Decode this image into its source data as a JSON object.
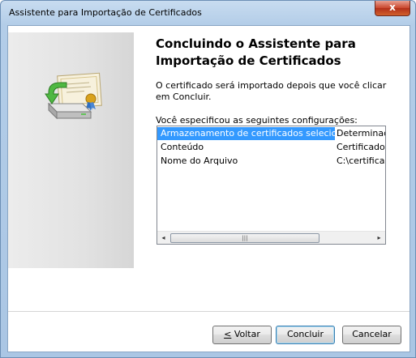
{
  "window": {
    "title": "Assistente para Importação de Certificados",
    "close_glyph": "x"
  },
  "wizard": {
    "heading_line1": "Concluindo o Assistente para",
    "heading_line2": "Importação de Certificados",
    "intro": "O certificado será importado depois que você clicar em Concluir.",
    "list_label": "Você especificou as seguintes configurações:",
    "settings": [
      {
        "name": "Armazenamento de certificados selecionado",
        "value": "Determinado"
      },
      {
        "name": "Conteúdo",
        "value": "Certificado"
      },
      {
        "name": "Nome do Arquivo",
        "value": "C:\\certificad"
      }
    ]
  },
  "buttons": {
    "back_mnemonic": "<",
    "back_rest": " Voltar",
    "finish": "Concluir",
    "cancel": "Cancelar"
  },
  "icons": {
    "wizard_art": "certificate-import-icon",
    "scroll_left": "◂",
    "scroll_right": "▸",
    "scroll_grip": "|||"
  }
}
